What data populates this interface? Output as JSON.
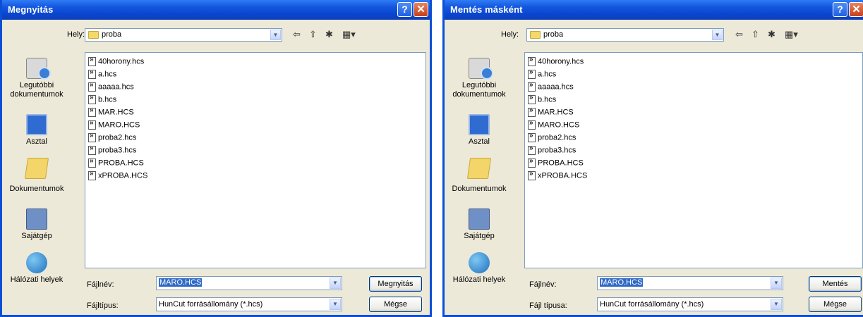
{
  "dialogs": [
    {
      "title": "Megnyitás",
      "location_label": "Hely:",
      "location_value": "proba",
      "places": [
        "Legutóbbi dokumentumok",
        "Asztal",
        "Dokumentumok",
        "Sajátgép",
        "Hálózati helyek"
      ],
      "files": [
        "40horony.hcs",
        "a.hcs",
        "aaaaa.hcs",
        "b.hcs",
        "MAR.HCS",
        "MARO.HCS",
        "proba2.hcs",
        "proba3.hcs",
        "PROBA.HCS",
        "xPROBA.HCS"
      ],
      "filename_label": "Fájlnév:",
      "filename_value": "MARO.HCS",
      "filetype_label": "Fájltípus:",
      "filetype_value": "HunCut forrásállomány (*.hcs)",
      "primary_button": "Megnyitás",
      "cancel_button": "Mégse"
    },
    {
      "title": "Mentés másként",
      "location_label": "Hely:",
      "location_value": "proba",
      "places": [
        "Legutóbbi dokumentumok",
        "Asztal",
        "Dokumentumok",
        "Sajátgép",
        "Hálózati helyek"
      ],
      "files": [
        "40horony.hcs",
        "a.hcs",
        "aaaaa.hcs",
        "b.hcs",
        "MAR.HCS",
        "MARO.HCS",
        "proba2.hcs",
        "proba3.hcs",
        "PROBA.HCS",
        "xPROBA.HCS"
      ],
      "filename_label": "Fájlnév:",
      "filename_value": "MARO.HCS",
      "filetype_label": "Fájl típusa:",
      "filetype_value": "HunCut forrásállomány (*.hcs)",
      "primary_button": "Mentés",
      "cancel_button": "Mégse"
    }
  ],
  "icons": {
    "help": "question-mark-icon",
    "close": "close-x-icon",
    "back": "back-arrow-icon",
    "up_folder": "up-folder-icon",
    "new_folder": "new-folder-icon",
    "view_menu": "view-menu-icon"
  },
  "colors": {
    "titlebar": "#0a46d0",
    "dialog_bg": "#ece9d8",
    "selection": "#316ac5"
  }
}
